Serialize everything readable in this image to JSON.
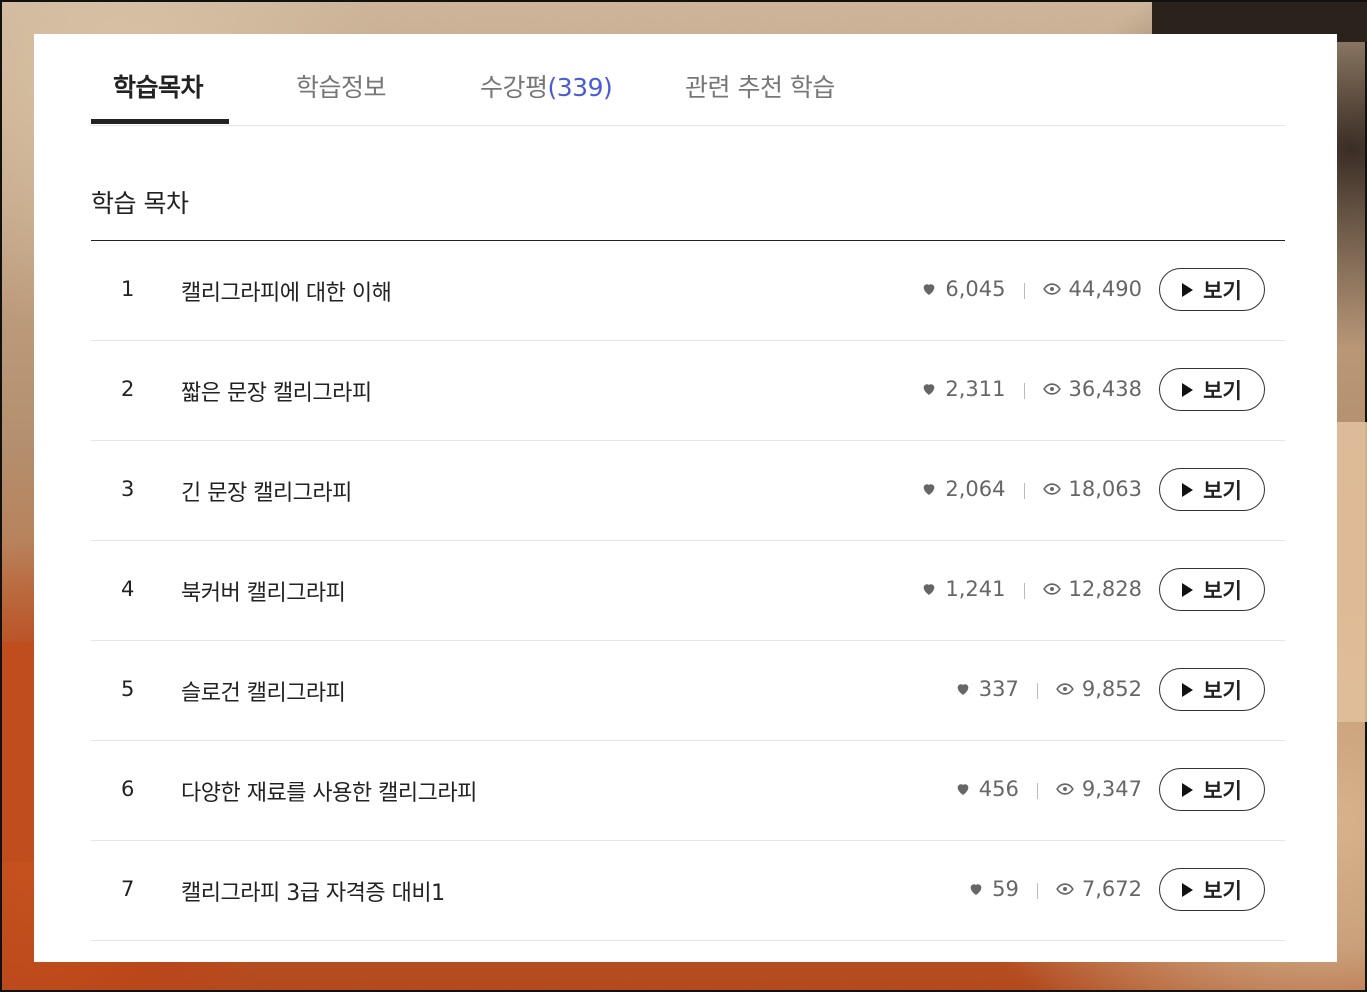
{
  "tabs": [
    {
      "label": "학습목차",
      "active": true
    },
    {
      "label": "학습정보",
      "active": false
    },
    {
      "label": "수강평",
      "count": "(339)",
      "active": false
    },
    {
      "label": "관련 추천 학습",
      "active": false
    }
  ],
  "section_title": "학습 목차",
  "lessons": [
    {
      "num": "1",
      "title": "캘리그라피에 대한 이해",
      "likes": "6,045",
      "views": "44,490",
      "button": "보기"
    },
    {
      "num": "2",
      "title": "짧은 문장 캘리그라피",
      "likes": "2,311",
      "views": "36,438",
      "button": "보기"
    },
    {
      "num": "3",
      "title": "긴 문장 캘리그라피",
      "likes": "2,064",
      "views": "18,063",
      "button": "보기"
    },
    {
      "num": "4",
      "title": "북커버 캘리그라피",
      "likes": "1,241",
      "views": "12,828",
      "button": "보기"
    },
    {
      "num": "5",
      "title": "슬로건 캘리그라피",
      "likes": "337",
      "views": "9,852",
      "button": "보기"
    },
    {
      "num": "6",
      "title": "다양한 재료를 사용한 캘리그라피",
      "likes": "456",
      "views": "9,347",
      "button": "보기"
    },
    {
      "num": "7",
      "title": "캘리그라피 3급 자격증 대비1",
      "likes": "59",
      "views": "7,672",
      "button": "보기"
    }
  ],
  "colors": {
    "accent": "#4b5bd6",
    "text": "#222222",
    "muted": "#666666"
  },
  "icons": {
    "likes": "heart-icon",
    "views": "eye-icon",
    "play": "play-icon"
  }
}
